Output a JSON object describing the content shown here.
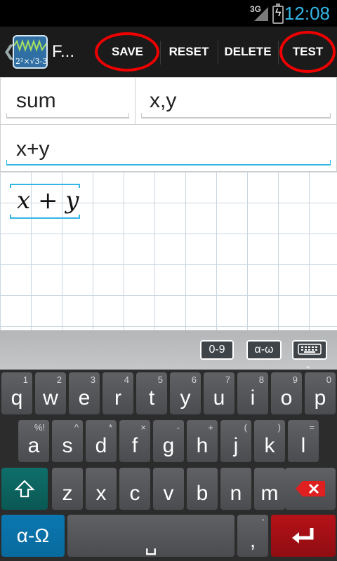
{
  "status_bar": {
    "network": "3G",
    "time": "12:08"
  },
  "action_bar": {
    "app_title": "F...",
    "icon_formula": "2²×√3-3/2",
    "buttons": {
      "save": "SAVE",
      "reset": "RESET",
      "delete": "DELETE",
      "test": "TEST"
    }
  },
  "fields": {
    "name": "sum",
    "variables": "x,y",
    "expression": "x+y"
  },
  "canvas": {
    "rendered_formula": "x + y"
  },
  "keyboard": {
    "modes": {
      "digits": "0-9",
      "greek": "α-ω"
    },
    "row1": [
      {
        "main": "q",
        "sub": "1"
      },
      {
        "main": "w",
        "sub": "2"
      },
      {
        "main": "e",
        "sub": "3"
      },
      {
        "main": "r",
        "sub": "4"
      },
      {
        "main": "t",
        "sub": "5"
      },
      {
        "main": "y",
        "sub": "6"
      },
      {
        "main": "u",
        "sub": "7"
      },
      {
        "main": "i",
        "sub": "8"
      },
      {
        "main": "o",
        "sub": "9"
      },
      {
        "main": "p",
        "sub": "0"
      }
    ],
    "row2": [
      {
        "main": "a",
        "sub": "%!"
      },
      {
        "main": "s",
        "sub": "^"
      },
      {
        "main": "d",
        "sub": "*"
      },
      {
        "main": "f",
        "sub": "×"
      },
      {
        "main": "g",
        "sub": "-"
      },
      {
        "main": "h",
        "sub": "+"
      },
      {
        "main": "j",
        "sub": "("
      },
      {
        "main": "k",
        "sub": ")"
      },
      {
        "main": "l",
        "sub": "="
      }
    ],
    "row3": [
      {
        "main": "z",
        "sub": ""
      },
      {
        "main": "x",
        "sub": ""
      },
      {
        "main": "c",
        "sub": ""
      },
      {
        "main": "v",
        "sub": ""
      },
      {
        "main": "b",
        "sub": ""
      },
      {
        "main": "n",
        "sub": ""
      },
      {
        "main": "m",
        "sub": ""
      }
    ],
    "greek_key": "α-Ω",
    "comma_key": ",",
    "comma_sub": "'",
    "space_glyph": "␣"
  }
}
